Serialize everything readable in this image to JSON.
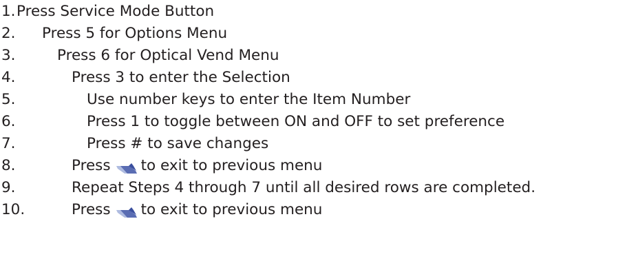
{
  "steps": [
    {
      "num": "1.",
      "text": "Press Service Mode Button"
    },
    {
      "num": "2.",
      "text": "Press 5 for Options Menu"
    },
    {
      "num": "3.",
      "text": "Press 6 for Optical Vend Menu"
    },
    {
      "num": "4.",
      "text": "Press 3 to enter the Selection"
    },
    {
      "num": "5.",
      "text": "Use number keys to enter the Item Number"
    },
    {
      "num": "6.",
      "text": "Press 1 to toggle between ON and OFF to set preference"
    },
    {
      "num": "7.",
      "text": "Press # to save changes"
    },
    {
      "num": "8.",
      "text_before": "Press",
      "icon": "back-arrow-key-icon",
      "text_after": "to exit to previous menu"
    },
    {
      "num": "9.",
      "text": "Repeat Steps 4 through 7 until all desired rows are completed."
    },
    {
      "num": "10.",
      "text_before": "Press",
      "icon": "back-arrow-key-icon",
      "text_after": "to exit to previous menu"
    }
  ],
  "colors": {
    "text": "#231f20",
    "icon_dark": "#3a4f9e",
    "icon_light": "#aebbe0"
  }
}
